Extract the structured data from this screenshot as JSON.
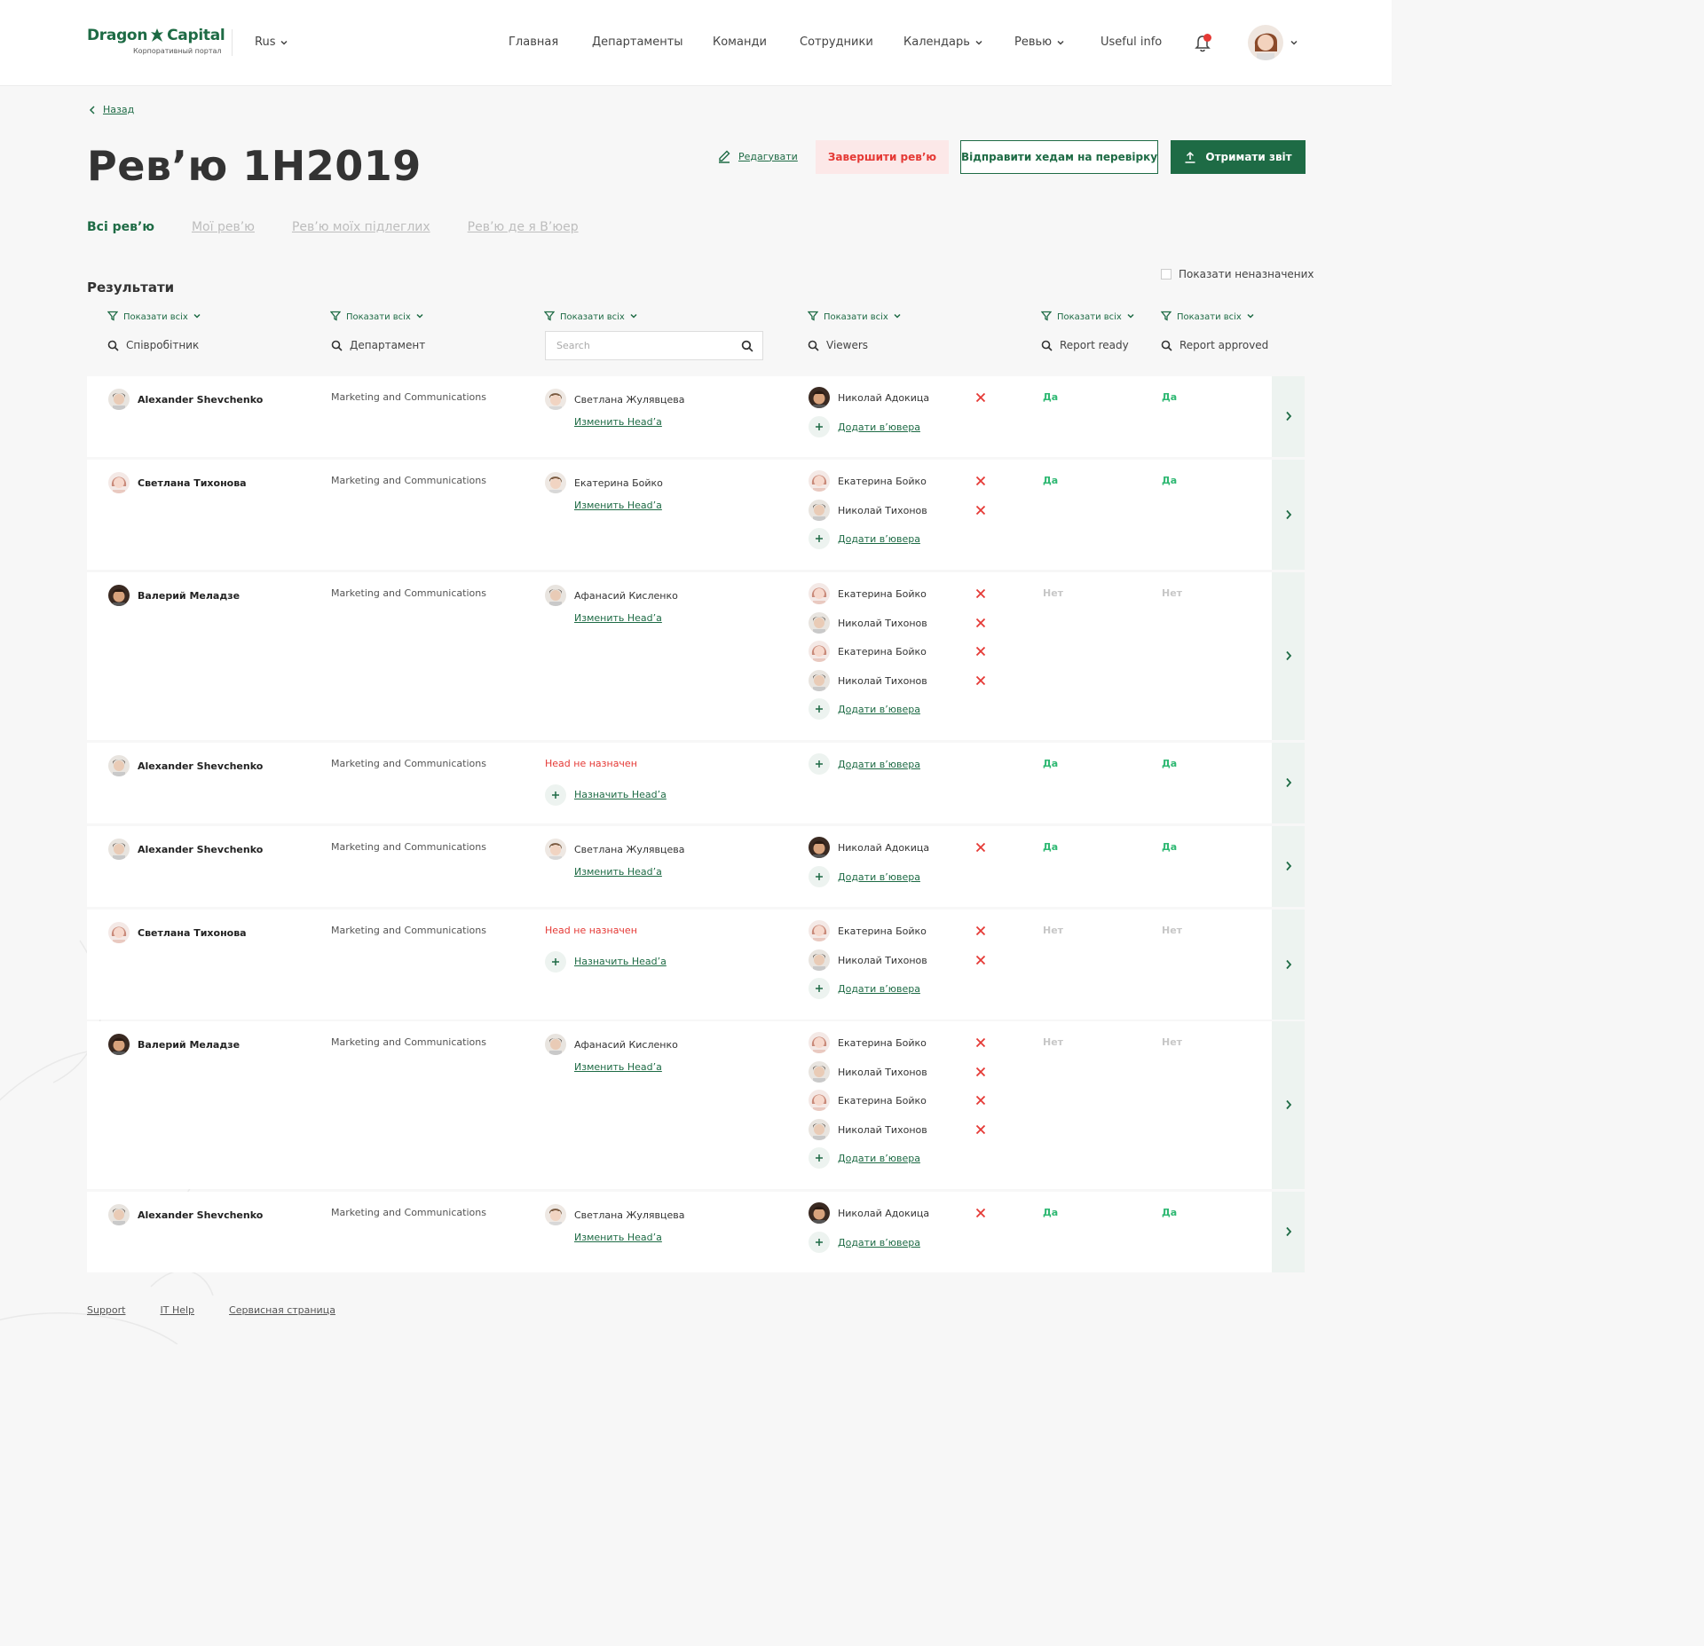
{
  "header": {
    "brand_left": "Dragon",
    "brand_right": "Capital",
    "brand_sub": "Корпоративный портал",
    "lang": "Rus",
    "nav": [
      {
        "label": "Главная",
        "dropdown": false
      },
      {
        "label": "Департаменты",
        "dropdown": false
      },
      {
        "label": "Команди",
        "dropdown": false
      },
      {
        "label": "Сотрудники",
        "dropdown": false
      },
      {
        "label": "Календарь",
        "dropdown": true
      },
      {
        "label": "Ревью",
        "dropdown": true
      },
      {
        "label": "Useful info",
        "dropdown": false
      }
    ]
  },
  "back_label": "Назад",
  "title": "Рев’ю 1H2019",
  "actions": {
    "edit": "Редагувати",
    "finish": "Завершити рев’ю",
    "send": "Відправити хедам на перевірку",
    "report": "Отримати звіт"
  },
  "tabs": [
    {
      "label": "Всі рев’ю",
      "active": true
    },
    {
      "label": "Мої рев’ю",
      "active": false
    },
    {
      "label": "Рев’ю моїх підлеглих",
      "active": false
    },
    {
      "label": "Рев’ю де я В’юер",
      "active": false
    }
  ],
  "results_title": "Результати",
  "show_unassigned": "Показати неназначених",
  "filter_label": "Показати всіх",
  "columns": {
    "employee": "Співробітник",
    "department": "Департамент",
    "head_search_placeholder": "Search",
    "viewers": "Viewers",
    "report_ready": "Report ready",
    "report_approved": "Report approved"
  },
  "labels": {
    "change_head": "Изменить Head’a",
    "assign_head": "Назначить Head’a",
    "head_none": "Head не назначен",
    "add_viewer": "Додати в’ювера"
  },
  "rows": [
    {
      "employee": "Alexander Shevchenko",
      "emp_av": "m1",
      "department": "Marketing and Communications",
      "head": "Светлана Жулявцева",
      "head_av": "m2",
      "viewers": [
        {
          "name": "Николай Адокица",
          "av": "m3"
        }
      ],
      "ready": "Да",
      "approved": "Да"
    },
    {
      "employee": "Светлана Тихонова",
      "emp_av": "f1",
      "department": "Marketing and Communications",
      "head": "Екатерина Бойко",
      "head_av": "m2",
      "viewers": [
        {
          "name": "Екатерина Бойко",
          "av": "f1"
        },
        {
          "name": "Николай Тихонов",
          "av": "m1"
        }
      ],
      "ready": "Да",
      "approved": "Да"
    },
    {
      "employee": "Валерий Меладзе",
      "emp_av": "m3",
      "department": "Marketing and Communications",
      "head": "Афанасий Кисленко",
      "head_av": "m1",
      "viewers": [
        {
          "name": "Екатерина Бойко",
          "av": "f1"
        },
        {
          "name": "Николай Тихонов",
          "av": "m1"
        },
        {
          "name": "Екатерина Бойко",
          "av": "f1"
        },
        {
          "name": "Николай Тихонов",
          "av": "m1"
        }
      ],
      "ready": "Нет",
      "approved": "Нет"
    },
    {
      "employee": "Alexander Shevchenko",
      "emp_av": "m1",
      "department": "Marketing and Communications",
      "head": null,
      "head_av": null,
      "viewers": [],
      "ready": "Да",
      "approved": "Да"
    },
    {
      "employee": "Alexander Shevchenko",
      "emp_av": "m1",
      "department": "Marketing and Communications",
      "head": "Светлана Жулявцева",
      "head_av": "m2",
      "viewers": [
        {
          "name": "Николай Адокица",
          "av": "m3"
        }
      ],
      "ready": "Да",
      "approved": "Да"
    },
    {
      "employee": "Светлана Тихонова",
      "emp_av": "f1",
      "department": "Marketing and Communications",
      "head": null,
      "head_av": null,
      "viewers": [
        {
          "name": "Екатерина Бойко",
          "av": "f1"
        },
        {
          "name": "Николай Тихонов",
          "av": "m1"
        }
      ],
      "ready": "Нет",
      "approved": "Нет"
    },
    {
      "employee": "Валерий Меладзе",
      "emp_av": "m3",
      "department": "Marketing and Communications",
      "head": "Афанасий Кисленко",
      "head_av": "m1",
      "viewers": [
        {
          "name": "Екатерина Бойко",
          "av": "f1"
        },
        {
          "name": "Николай Тихонов",
          "av": "m1"
        },
        {
          "name": "Екатерина Бойко",
          "av": "f1"
        },
        {
          "name": "Николай Тихонов",
          "av": "m1"
        }
      ],
      "ready": "Нет",
      "approved": "Нет"
    },
    {
      "employee": "Alexander Shevchenko",
      "emp_av": "m1",
      "department": "Marketing and Communications",
      "head": "Светлана Жулявцева",
      "head_av": "m2",
      "viewers": [
        {
          "name": "Николай Адокица",
          "av": "m3"
        }
      ],
      "ready": "Да",
      "approved": "Да"
    }
  ],
  "footer": [
    "Support",
    "IT Help",
    "Сервисная страница"
  ],
  "colors": {
    "brand": "#1e6b45",
    "danger": "#e53935",
    "success": "#2eb872"
  }
}
